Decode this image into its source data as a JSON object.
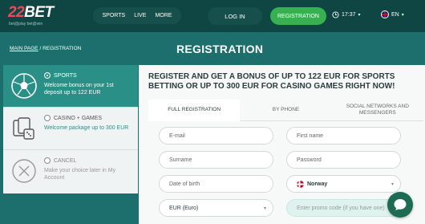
{
  "header": {
    "logo_number": "22",
    "logo_text": "BET",
    "logo_tagline": "bet@play bet@win",
    "nav": [
      "SPORTS",
      "LIVE",
      "MORE"
    ],
    "login_label": "LOG IN",
    "register_label": "REGISTRATION",
    "time": "17:37",
    "language": "EN"
  },
  "breadcrumb": {
    "home": "MAIN PAGE",
    "separator": "/",
    "current": "REGISTRATION"
  },
  "page_title": "REGISTRATION",
  "bonus_options": [
    {
      "title": "SPORTS",
      "desc": "Welcome bonus on your 1st deposit up to 122 EUR",
      "icon": "soccer-ball-icon"
    },
    {
      "title": "CASINO + GAMES",
      "desc": "Welcome package up to 300 EUR",
      "icon": "cards-dice-icon"
    },
    {
      "title": "CANCEL",
      "desc": "Make your choice later in My Account",
      "icon": "close-circle-icon"
    }
  ],
  "promo_heading": "REGISTER AND GET A BONUS OF UP TO 122 EUR FOR SPORTS BETTING OR UP TO 300 EUR FOR CASINO GAMES RIGHT NOW!",
  "tabs": [
    "FULL REGISTRATION",
    "BY PHONE",
    "SOCIAL NETWORKS AND MESSENGERS"
  ],
  "fields": {
    "email": "E-mail",
    "first_name": "First name",
    "surname": "Surname",
    "password": "Password",
    "dob": "Date of birth",
    "country": "Norway",
    "currency": "EUR (Euro)",
    "promo": "Enter promo code (if you have one)"
  },
  "colors": {
    "brand_bg": "#1c6f6c",
    "header_bg": "#0f4644",
    "accent_green": "#37b050",
    "active_option": "#2a8f86"
  }
}
